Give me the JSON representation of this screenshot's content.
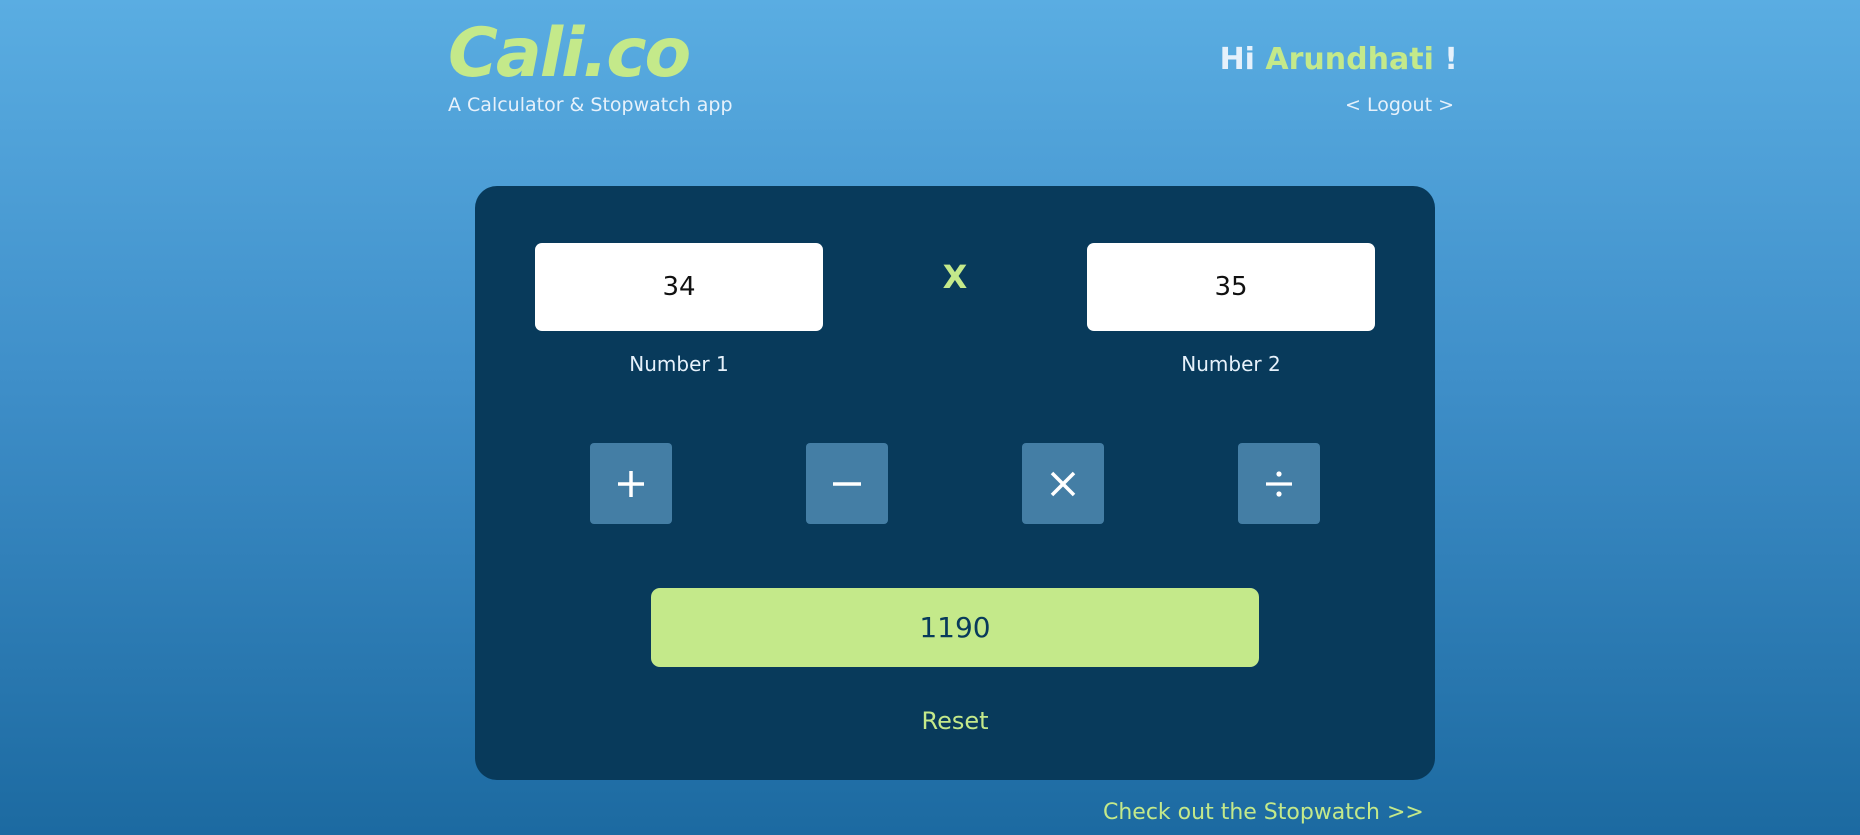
{
  "header": {
    "logo": "Cali.co",
    "tagline": "A Calculator & Stopwatch app",
    "greeting_prefix": "Hi ",
    "user_name": "Arundhati",
    "greeting_suffix": " !",
    "logout": "< Logout >"
  },
  "calculator": {
    "number1_value": "34",
    "number1_label": "Number 1",
    "operator_symbol": "X",
    "number2_value": "35",
    "number2_label": "Number 2",
    "operations": [
      {
        "name": "add",
        "icon": "plus-icon"
      },
      {
        "name": "subtract",
        "icon": "minus-icon"
      },
      {
        "name": "multiply",
        "icon": "multiply-icon"
      },
      {
        "name": "divide",
        "icon": "divide-icon"
      }
    ],
    "result": "1190",
    "reset_label": "Reset"
  },
  "footer": {
    "stopwatch_link": "Check out the Stopwatch >>"
  },
  "colors": {
    "accent": "#c4e98a",
    "card": "#083a5b",
    "op_button": "#447ea5"
  }
}
